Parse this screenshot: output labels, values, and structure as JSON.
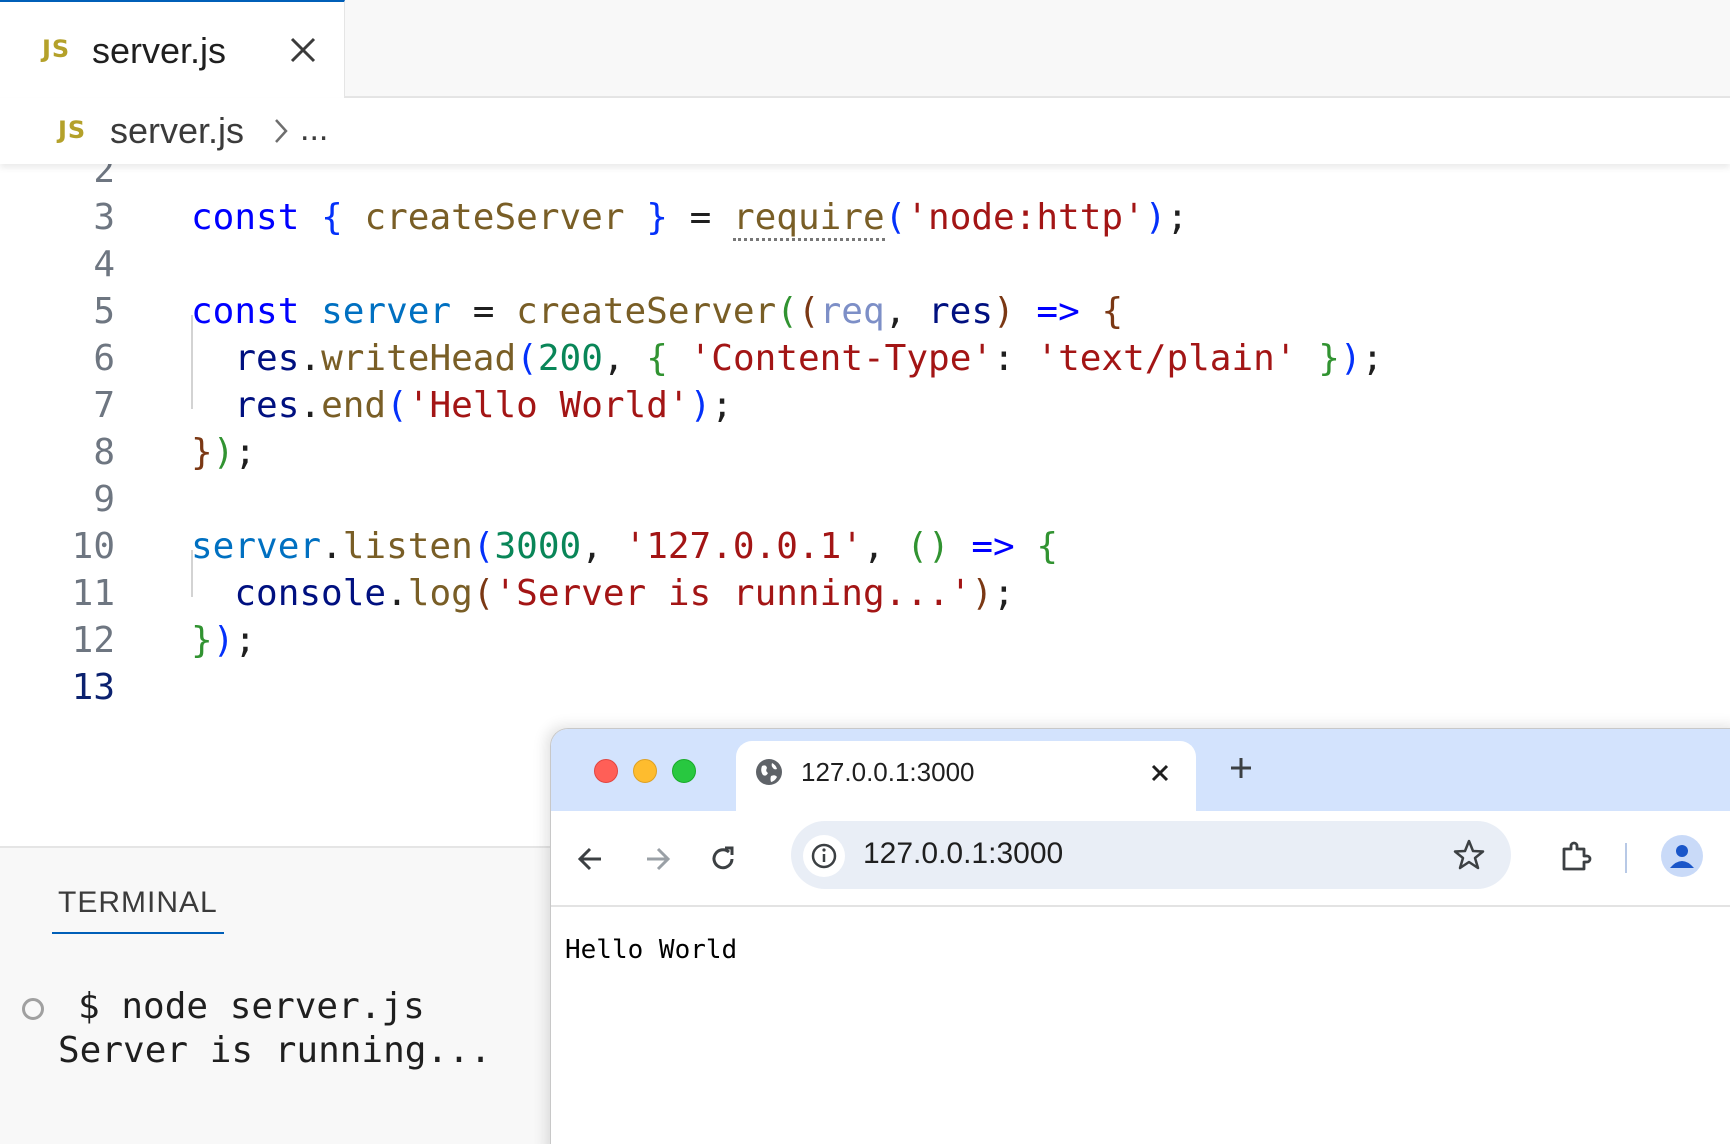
{
  "editor": {
    "tab": {
      "badge": "JS",
      "label": "server.js"
    },
    "breadcrumb": {
      "badge": "JS",
      "file": "server.js",
      "more": "..."
    },
    "lines": [
      {
        "num": "2",
        "html": ""
      },
      {
        "num": "3",
        "html": "<span class=\"kw\">const</span> <span class=\"b1\">{</span> <span class=\"fn\">createServer</span> <span class=\"b1\">}</span> = <span class=\"fn squig\">require</span><span class=\"b1\">(</span><span class=\"st\">'node:http'</span><span class=\"b1\">)</span>;"
      },
      {
        "num": "4",
        "html": ""
      },
      {
        "num": "5",
        "html": "<span class=\"kw\">const</span> <span class=\"vb\">server</span> = <span class=\"fn\">createServer</span><span class=\"b2\">(</span><span class=\"b3\">(</span><span class=\"unused\">req</span>, <span class=\"pr\">res</span><span class=\"b3\">)</span> <span class=\"kw\">=&gt;</span> <span class=\"b3\">{</span>"
      },
      {
        "num": "6",
        "html": "  <span class=\"pr\">res</span>.<span class=\"fn\">writeHead</span><span class=\"b1\">(</span><span class=\"nm\">200</span>, <span class=\"b2\">{</span> <span class=\"st\">'Content-Type'</span>: <span class=\"st\">'text/plain'</span> <span class=\"b2\">}</span><span class=\"b1\">)</span>;"
      },
      {
        "num": "7",
        "html": "  <span class=\"pr\">res</span>.<span class=\"fn\">end</span><span class=\"b1\">(</span><span class=\"st\">'Hello World'</span><span class=\"b1\">)</span>;"
      },
      {
        "num": "8",
        "html": "<span class=\"b3\">}</span><span class=\"b2\">)</span>;"
      },
      {
        "num": "9",
        "html": ""
      },
      {
        "num": "10",
        "html": "<span class=\"vb\">server</span>.<span class=\"fn\">listen</span><span class=\"b1\">(</span><span class=\"nm\">3000</span>, <span class=\"st\">'127.0.0.1'</span>, <span class=\"b2\">()</span> <span class=\"kw\">=&gt;</span> <span class=\"b2\">{</span>"
      },
      {
        "num": "11",
        "html": "  <span class=\"pr\">console</span>.<span class=\"fn\">log</span><span class=\"b3\">(</span><span class=\"st\">'Server is running...'</span><span class=\"b3\">)</span>;"
      },
      {
        "num": "12",
        "html": "<span class=\"b2\">}</span><span class=\"b1\">)</span>;"
      },
      {
        "num": "13",
        "html": ""
      }
    ]
  },
  "terminal": {
    "tab_label": "TERMINAL",
    "command": "$ node server.js",
    "output": "Server is running..."
  },
  "browser": {
    "tab_title": "127.0.0.1:3000",
    "url": "127.0.0.1:3000",
    "page_text": "Hello World"
  }
}
